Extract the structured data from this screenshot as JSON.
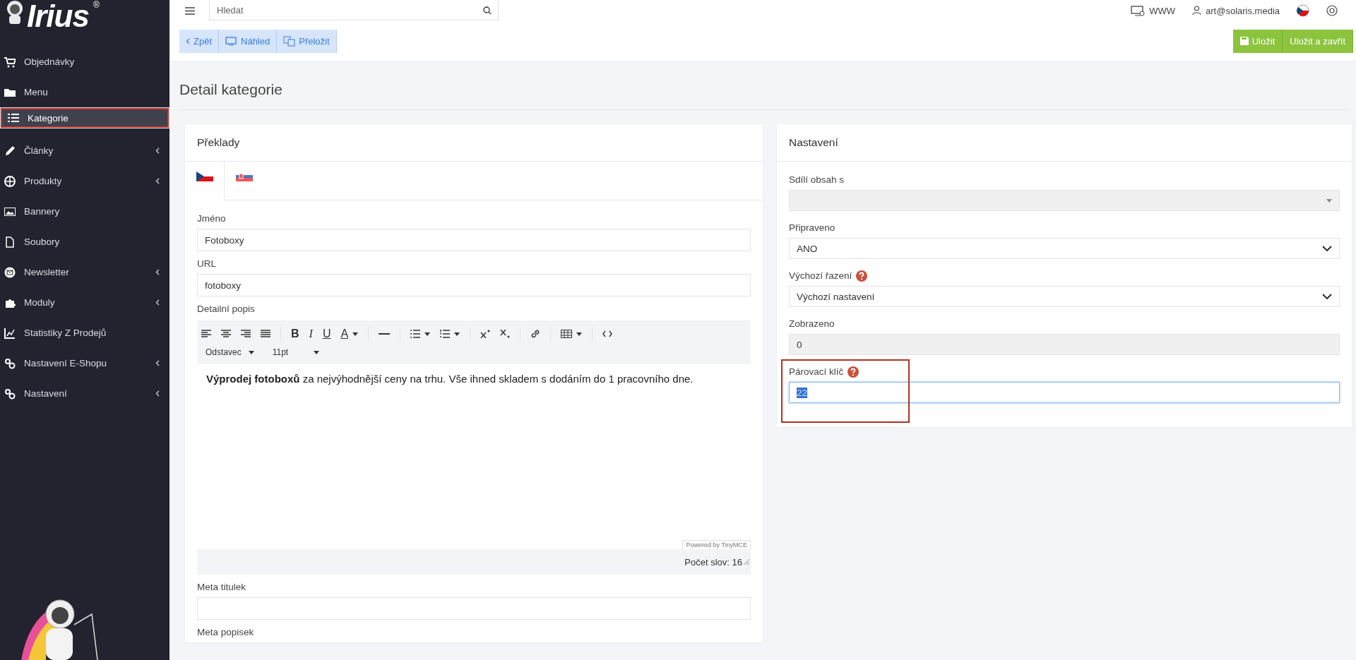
{
  "logo": {
    "text": "Irius",
    "mark": "®"
  },
  "topbar": {
    "search_placeholder": "Hledat",
    "links": [
      {
        "label": "WWW"
      },
      {
        "label": "art@solaris.media"
      }
    ]
  },
  "sidebar": {
    "items": [
      {
        "label": "Objednávky",
        "selected": false,
        "submenu": false
      },
      {
        "label": "Menu",
        "selected": false,
        "submenu": false
      },
      {
        "label": "Kategorie",
        "selected": true,
        "submenu": false
      },
      {
        "label": "Články",
        "selected": false,
        "submenu": true
      },
      {
        "label": "Produkty",
        "selected": false,
        "submenu": true
      },
      {
        "label": "Bannery",
        "selected": false,
        "submenu": false
      },
      {
        "label": "Soubory",
        "selected": false,
        "submenu": false
      },
      {
        "label": "Newsletter",
        "selected": false,
        "submenu": true
      },
      {
        "label": "Moduly",
        "selected": false,
        "submenu": true
      },
      {
        "label": "Statistiky Z Prodejů",
        "selected": false,
        "submenu": false
      },
      {
        "label": "Nastavení E-Shopu",
        "selected": false,
        "submenu": true
      },
      {
        "label": "Nastavení",
        "selected": false,
        "submenu": true
      }
    ]
  },
  "actions": {
    "left": [
      {
        "label": "Zpět"
      },
      {
        "label": "Náhled"
      },
      {
        "label": "Přeložit"
      }
    ],
    "right": [
      {
        "label": "Uložit"
      },
      {
        "label": "Uložit a zavřít"
      }
    ]
  },
  "page_title": "Detail kategorie",
  "translations": {
    "title": "Překlady",
    "tabs": [
      {
        "selected": true
      },
      {
        "selected": false
      }
    ],
    "name_label": "Jméno",
    "name_value": "Fotoboxy",
    "url_label": "URL",
    "url_value": "fotoboxy",
    "description_label": "Detailní popis",
    "editor": {
      "format_buttons": [
        "B",
        "I",
        "U",
        "A"
      ],
      "block_format": "Odstavec",
      "font_size": "11pt",
      "content": "**Výprodej fotoboxů** za nejvýhodnější ceny na trhu. Vše ihned skladem s dodáním do 1 pracovního dne.",
      "branding": "Powered by TinyMCE",
      "word_count": "Počet slov: 16"
    },
    "meta_title_label": "Meta titulek",
    "meta_description_label": "Meta popisek"
  },
  "settings": {
    "title": "Nastavení",
    "fields": [
      {
        "kind": "select",
        "label": "Sdílí obsah s",
        "disabled": true,
        "help": false,
        "focused": false
      },
      {
        "kind": "select",
        "label": "Připraveno",
        "value": "ANO",
        "disabled": false,
        "help": false,
        "focused": false
      },
      {
        "kind": "select",
        "label": "Výchozí řazení",
        "value": "Výchozí nastavení",
        "disabled": false,
        "help": true,
        "focused": false
      },
      {
        "kind": "input",
        "label": "Zobrazeno",
        "value": "0",
        "disabled": true,
        "help": false,
        "focused": false
      },
      {
        "kind": "input",
        "label": "Párovací klíč",
        "value": "22",
        "disabled": false,
        "help": true,
        "focused": true
      }
    ]
  }
}
